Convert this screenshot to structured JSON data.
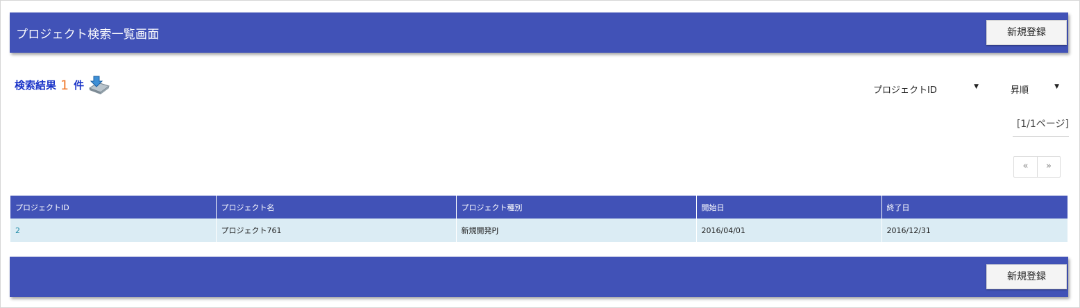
{
  "header": {
    "title": "プロジェクト検索一覧画面",
    "new_button": "新規登録"
  },
  "results": {
    "label": "検索結果",
    "count": "1",
    "unit": "件",
    "export_icon": "export-download-icon"
  },
  "sort": {
    "field_value": "プロジェクトID",
    "order_value": "昇順"
  },
  "pagination": {
    "page_info": "[1/1ページ]",
    "prev": "«",
    "next": "»"
  },
  "table": {
    "headers": [
      "プロジェクトID",
      "プロジェクト名",
      "プロジェクト種別",
      "開始日",
      "終了日"
    ],
    "rows": [
      [
        "2",
        "プロジェクト761",
        "新規開発PJ",
        "2016/04/01",
        "2016/12/31"
      ]
    ]
  },
  "footer": {
    "new_button": "新規登録"
  },
  "colors": {
    "bar": "#4152b7",
    "row": "#dbecf4",
    "count": "#f0782a",
    "link": "#1e8aa6"
  }
}
